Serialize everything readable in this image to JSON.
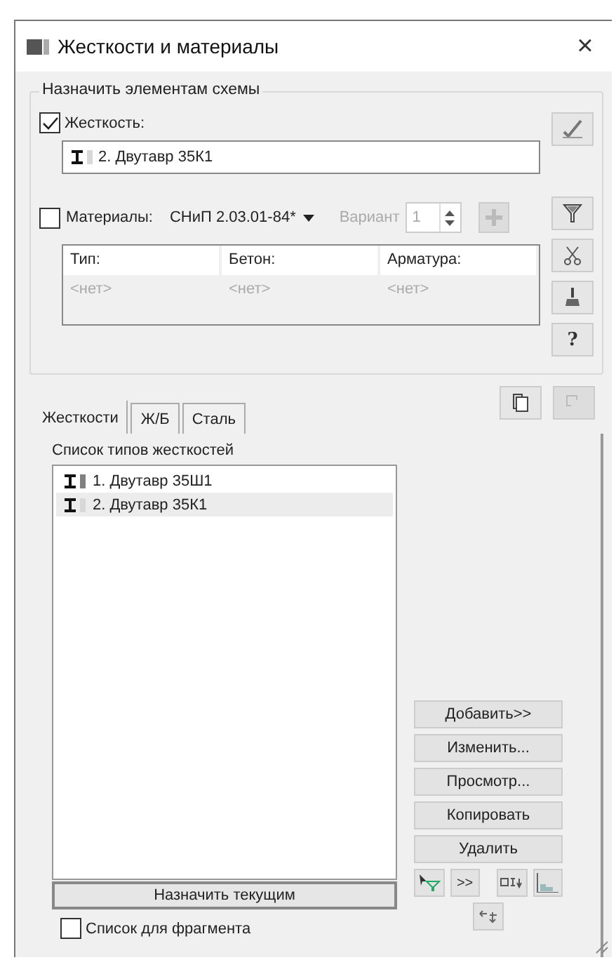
{
  "window": {
    "title": "Жесткости и материалы",
    "close": "×"
  },
  "assign_group": {
    "title": "Назначить элементам схемы",
    "stiffness": {
      "label": "Жесткость:",
      "checked": true
    },
    "stiffness_value": {
      "label": "2. Двутавр 35К1",
      "color": "#d8d8d8"
    },
    "materials": {
      "label": "Материалы:",
      "checked": false,
      "norm": "СНиП 2.03.01-84*"
    },
    "variant": {
      "label": "Вариант",
      "value": "1",
      "disabled": true
    },
    "table": {
      "columns": [
        "Тип:",
        "Бетон:",
        "Арматура:"
      ],
      "rows": [
        [
          "<нет>",
          "<нет>",
          "<нет>"
        ]
      ]
    },
    "help_button": "?"
  },
  "tabs": [
    {
      "label": "Жесткости",
      "selected": true
    },
    {
      "label": "Ж/Б",
      "selected": false
    },
    {
      "label": "Сталь",
      "selected": false
    }
  ],
  "paste_disabled": true,
  "list": {
    "title": "Список типов жесткостей",
    "items": [
      {
        "label": "1. Двутавр 35Ш1",
        "color": "#808080",
        "selected": false
      },
      {
        "label": "2. Двутавр 35К1",
        "color": "#d8d8d8",
        "selected": true
      }
    ]
  },
  "actions": [
    "Добавить>>",
    "Изменить...",
    "Просмотр...",
    "Копировать",
    "Удалить"
  ],
  "forward_button": ">>",
  "assign_button": "Назначить текущим",
  "fragment": {
    "label": "Список для фрагмента",
    "checked": false
  }
}
